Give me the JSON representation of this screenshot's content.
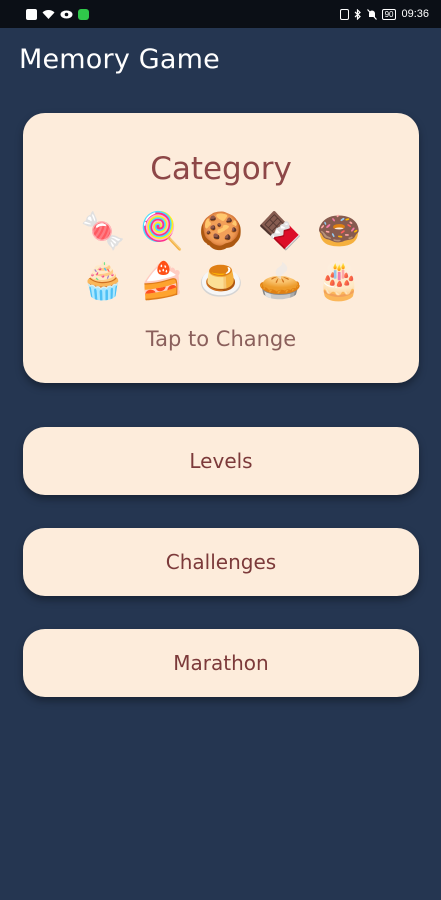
{
  "status_bar": {
    "battery": "90",
    "time": "09:36"
  },
  "app": {
    "title": "Memory Game"
  },
  "category": {
    "title": "Category",
    "hint": "Tap to Change",
    "icons": [
      {
        "name": "candy-icon",
        "glyph": "🍬"
      },
      {
        "name": "lollipop-icon",
        "glyph": "🍭"
      },
      {
        "name": "cookie-icon",
        "glyph": "🍪"
      },
      {
        "name": "chocolate-bar-icon",
        "glyph": "🍫"
      },
      {
        "name": "doughnut-icon",
        "glyph": "🍩"
      },
      {
        "name": "cupcake-icon",
        "glyph": "🧁"
      },
      {
        "name": "shortcake-icon",
        "glyph": "🍰"
      },
      {
        "name": "custard-icon",
        "glyph": "🍮"
      },
      {
        "name": "pie-icon",
        "glyph": "🥧"
      },
      {
        "name": "birthday-cake-icon",
        "glyph": "🎂"
      }
    ]
  },
  "menu": {
    "levels": "Levels",
    "challenges": "Challenges",
    "marathon": "Marathon"
  },
  "colors": {
    "background": "#253651",
    "card": "#fdecdb",
    "title_text": "#8d4747",
    "button_text": "#7c3a3a"
  }
}
